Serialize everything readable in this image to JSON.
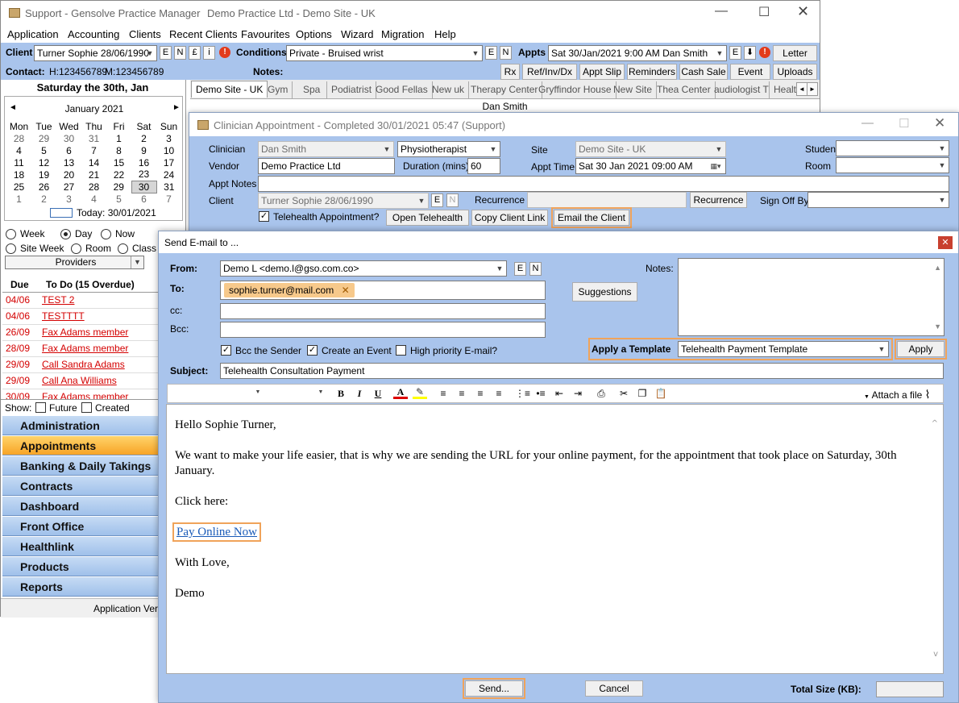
{
  "main_window": {
    "title": "Support - Gensolve Practice Manager",
    "site": "Demo Practice Ltd - Demo Site - UK",
    "menu": [
      "Application",
      "Accounting",
      "Clients",
      "Recent Clients",
      "Favourites",
      "Options",
      "Wizard",
      "Migration",
      "Help"
    ],
    "client_label": "Client",
    "client_value": "Turner Sophie 28/06/1990",
    "client_btns": [
      "E",
      "N",
      "£",
      "i"
    ],
    "conditions_label": "Conditions",
    "conditions_value": "Private - Bruised wrist",
    "cond_btns": [
      "E",
      "N"
    ],
    "appts_label": "Appts",
    "appts_value": "Sat 30/Jan/2021  9:00 AM Dan Smith",
    "appts_btns": [
      "E",
      "⬇"
    ],
    "letter_btn": "Letter",
    "contact_label": "Contact:",
    "contact_h": "H:123456789",
    "contact_m": "M:123456789",
    "notes_label": "Notes:",
    "action_btns": [
      "Rx",
      "Ref/Inv/Dx",
      "Appt Slip",
      "Reminders",
      "Cash Sale",
      "Event",
      "Uploads"
    ]
  },
  "sidebar": {
    "date_header": "Saturday the 30th, Jan",
    "month_label": "January 2021",
    "weekdays": [
      "Mon",
      "Tue",
      "Wed",
      "Thu",
      "Fri",
      "Sat",
      "Sun"
    ],
    "weeks": [
      [
        "28",
        "29",
        "30",
        "31",
        "1",
        "2",
        "3"
      ],
      [
        "4",
        "5",
        "6",
        "7",
        "8",
        "9",
        "10"
      ],
      [
        "11",
        "12",
        "13",
        "14",
        "15",
        "16",
        "17"
      ],
      [
        "18",
        "19",
        "20",
        "21",
        "22",
        "23",
        "24"
      ],
      [
        "25",
        "26",
        "27",
        "28",
        "29",
        "30",
        "31"
      ],
      [
        "1",
        "2",
        "3",
        "4",
        "5",
        "6",
        "7"
      ]
    ],
    "today_label": "Today: 30/01/2021",
    "views": [
      "Week",
      "Day",
      "Now",
      "Site Week",
      "Room",
      "Class"
    ],
    "providers_label": "Providers",
    "todo_due_header": "Due",
    "todo_header": "To Do (15 Overdue)",
    "todos": [
      {
        "due": "04/06",
        "text": "TEST 2"
      },
      {
        "due": "04/06",
        "text": "TESTTTT"
      },
      {
        "due": "26/09",
        "text": "Fax Adams member"
      },
      {
        "due": "28/09",
        "text": "Fax Adams member"
      },
      {
        "due": "29/09",
        "text": "Call Sandra Adams"
      },
      {
        "due": "29/09",
        "text": "Call Ana Williams"
      },
      {
        "due": "30/09",
        "text": "Fax Adams member"
      }
    ],
    "show_label": "Show:",
    "show_future": "Future",
    "show_created": "Created",
    "nav": [
      "Administration",
      "Appointments",
      "Banking & Daily Takings",
      "Contracts",
      "Dashboard",
      "Front Office",
      "Healthlink",
      "Products",
      "Reports"
    ],
    "status": "Application Version"
  },
  "tabs": [
    "Demo Site - UK",
    "Gym",
    "Spa",
    "Podiatrist",
    "Good Fellas",
    "New uk",
    "Therapy Center",
    "Gryffindor House",
    "New Site",
    "Thea Center",
    "audiologist T",
    "Healt"
  ],
  "schedule_header": "Dan Smith",
  "appt_window": {
    "title": "Clinician Appointment - Completed 30/01/2021 05:47 (Support)",
    "clinician_label": "Clinician",
    "clinician_value": "Dan Smith",
    "role_value": "Physiotherapist",
    "site_label": "Site",
    "site_value": "Demo Site - UK",
    "student_label": "Student",
    "vendor_label": "Vendor",
    "vendor_value": "Demo Practice Ltd",
    "duration_label": "Duration (mins)",
    "duration_value": "60",
    "appt_time_label": "Appt Time",
    "appt_time_value": "Sat  30 Jan  2021 09:00 AM",
    "room_label": "Room",
    "appt_notes_label": "Appt Notes",
    "client_label": "Client",
    "client_value": "Turner Sophie 28/06/1990",
    "recurrence_label": "Recurrence",
    "recurrence_btn": "Recurrence",
    "signoff_label": "Sign Off By",
    "telehealth_label": "Telehealth Appointment?",
    "open_telehealth": "Open Telehealth",
    "copy_link": "Copy Client Link",
    "email_client": "Email the Client"
  },
  "email_window": {
    "title": "Send E-mail to ...",
    "from_label": "From:",
    "from_value": "Demo L <demo.l@gso.com.co>",
    "to_label": "To:",
    "to_chip": "sophie.turner@mail.com",
    "cc_label": "cc:",
    "bcc_label": "Bcc:",
    "suggestions": "Suggestions",
    "notes_label": "Notes:",
    "bcc_sender": "Bcc the Sender",
    "create_event": "Create an Event",
    "high_priority": "High priority E-mail?",
    "template_label": "Apply a Template",
    "template_value": "Telehealth Payment Template",
    "apply": "Apply",
    "subject_label": "Subject:",
    "subject_value": "Telehealth Consultation Payment",
    "attach": "Attach a file",
    "body": {
      "greeting": "Hello Sophie Turner,",
      "line1": "We want to make your life easier, that is why we are sending the URL for your online payment, for the appointment that took place on Saturday, 30th January.",
      "click": "Click here:",
      "link": "Pay Online Now",
      "closing": "With Love,",
      "signature": "Demo"
    },
    "send": "Send...",
    "cancel": "Cancel",
    "total_size_label": "Total Size (KB):"
  },
  "colors": {
    "form_bg": "#a9c4ec",
    "highlight": "#f0a35a",
    "nav_active": "#f7a426",
    "overdue": "#d40000"
  }
}
